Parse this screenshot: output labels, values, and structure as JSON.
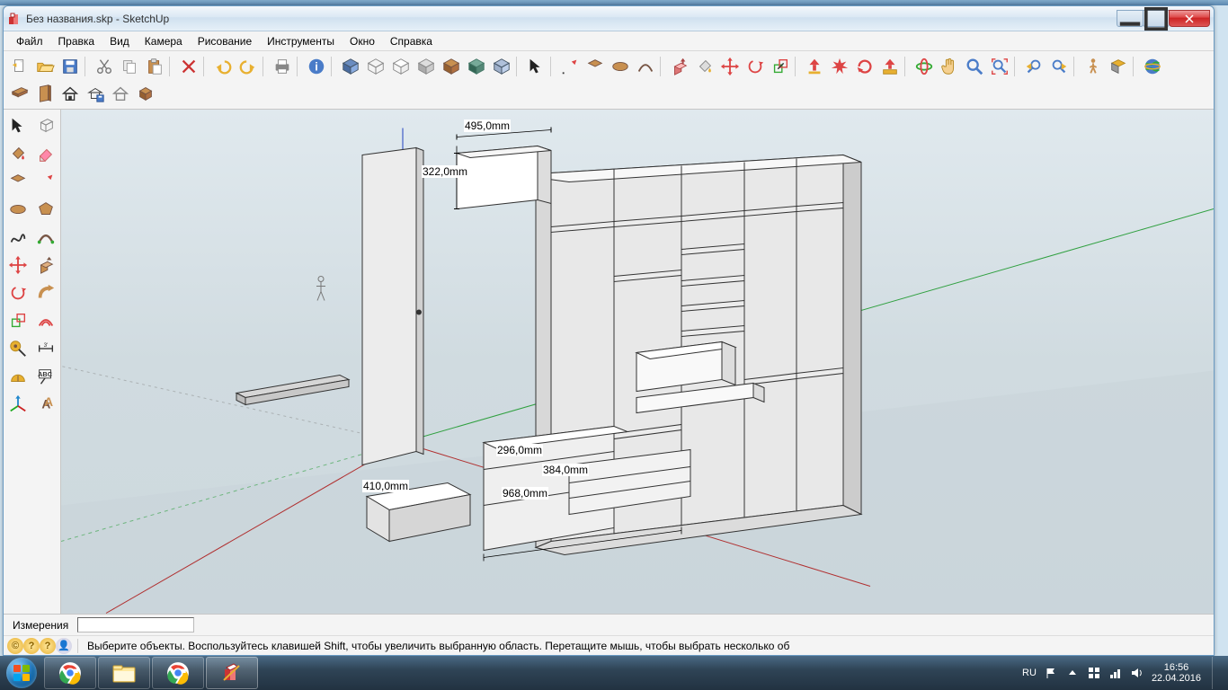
{
  "window": {
    "title": "Без названия.skp - SketchUp",
    "controls": {
      "minimize": "—",
      "maximize": "▭",
      "close": "✕"
    }
  },
  "menu": {
    "items": [
      "Файл",
      "Правка",
      "Вид",
      "Камера",
      "Рисование",
      "Инструменты",
      "Окно",
      "Справка"
    ]
  },
  "dimensions_in_view": {
    "d1": "495,0mm",
    "d2": "322,0mm",
    "d3": "296,0mm",
    "d4": "384,0mm",
    "d5": "968,0mm",
    "d6": "410,0mm"
  },
  "status": {
    "measure_label": "Измерения",
    "measure_value": ""
  },
  "hint_bar": {
    "text": "Выберите объекты. Воспользуйтесь клавишей Shift, чтобы увеличить выбранную область. Перетащите мышь, чтобы выбрать несколько об"
  },
  "tray": {
    "lang": "RU",
    "time": "16:56",
    "date": "22.04.2016"
  },
  "toolbar_icons_row1": [
    "new-file",
    "open-file",
    "save-file",
    "|",
    "cut",
    "copy",
    "paste",
    "|",
    "erase",
    "|",
    "undo",
    "redo",
    "|",
    "print",
    "|",
    "info",
    "|",
    "iso-view",
    "wireframe",
    "hidden-line",
    "shaded",
    "shaded-textures",
    "monochrome",
    "xray",
    "|",
    "select-arrow",
    "|",
    "pencil",
    "rectangle",
    "circle",
    "arc",
    "|",
    "push-pull",
    "paint-bucket",
    "move",
    "rotate",
    "scale",
    "|",
    "axis-up",
    "explode",
    "rotate-ccw",
    "flip",
    "|",
    "orbit",
    "pan",
    "zoom",
    "zoom-extents",
    "|",
    "prev-view",
    "next-view",
    "|",
    "person",
    "section",
    "|",
    "globe"
  ],
  "toolbar_icons_row2": [
    "component-board",
    "component-panel",
    "component-house",
    "component-save",
    "component-outline",
    "component-box"
  ],
  "side_toolbar": [
    [
      "select",
      "component-wire"
    ],
    [
      "paint",
      "eraser"
    ],
    [
      "rectangle",
      "pencil"
    ],
    [
      "circle",
      "polygon"
    ],
    [
      "freehand",
      "arc"
    ],
    [
      "move",
      "push-pull"
    ],
    [
      "rotate",
      "follow-me"
    ],
    [
      "scale",
      "offset"
    ],
    [
      "tape",
      "dimension"
    ],
    [
      "protractor",
      "text"
    ],
    [
      "axes",
      "3d-text"
    ]
  ]
}
